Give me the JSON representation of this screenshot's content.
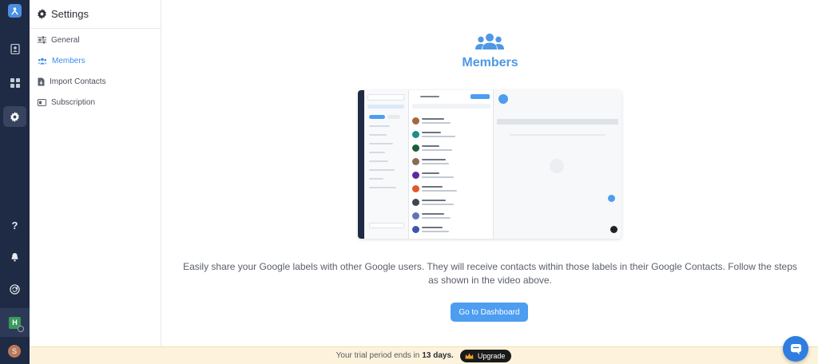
{
  "rail": {
    "items": [
      {
        "name": "contacts-icon"
      },
      {
        "name": "apps-grid-icon"
      },
      {
        "name": "settings-gear-icon"
      },
      {
        "name": "help-icon"
      },
      {
        "name": "notifications-bell-icon"
      },
      {
        "name": "sync-icon"
      }
    ],
    "workspace_initial": "H",
    "user_initial": "S"
  },
  "sidebar": {
    "title": "Settings",
    "items": [
      {
        "label": "General",
        "icon": "sliders-icon"
      },
      {
        "label": "Members",
        "icon": "users-icon",
        "active": true
      },
      {
        "label": "Import Contacts",
        "icon": "file-import-icon"
      },
      {
        "label": "Subscription",
        "icon": "card-icon"
      }
    ]
  },
  "main": {
    "title": "Members",
    "description": "Easily share your Google labels with other Google users. They will receive contacts within those labels in their Google Contacts. Follow the steps as shown in the video above.",
    "cta_label": "Go to Dashboard"
  },
  "trial": {
    "text": "Your trial period ends in",
    "days": "13 days.",
    "upgrade_label": "Upgrade"
  },
  "colors": {
    "accent": "#4d9df0",
    "rail": "#1f2a44",
    "trial_bg": "#fdf3dc"
  }
}
